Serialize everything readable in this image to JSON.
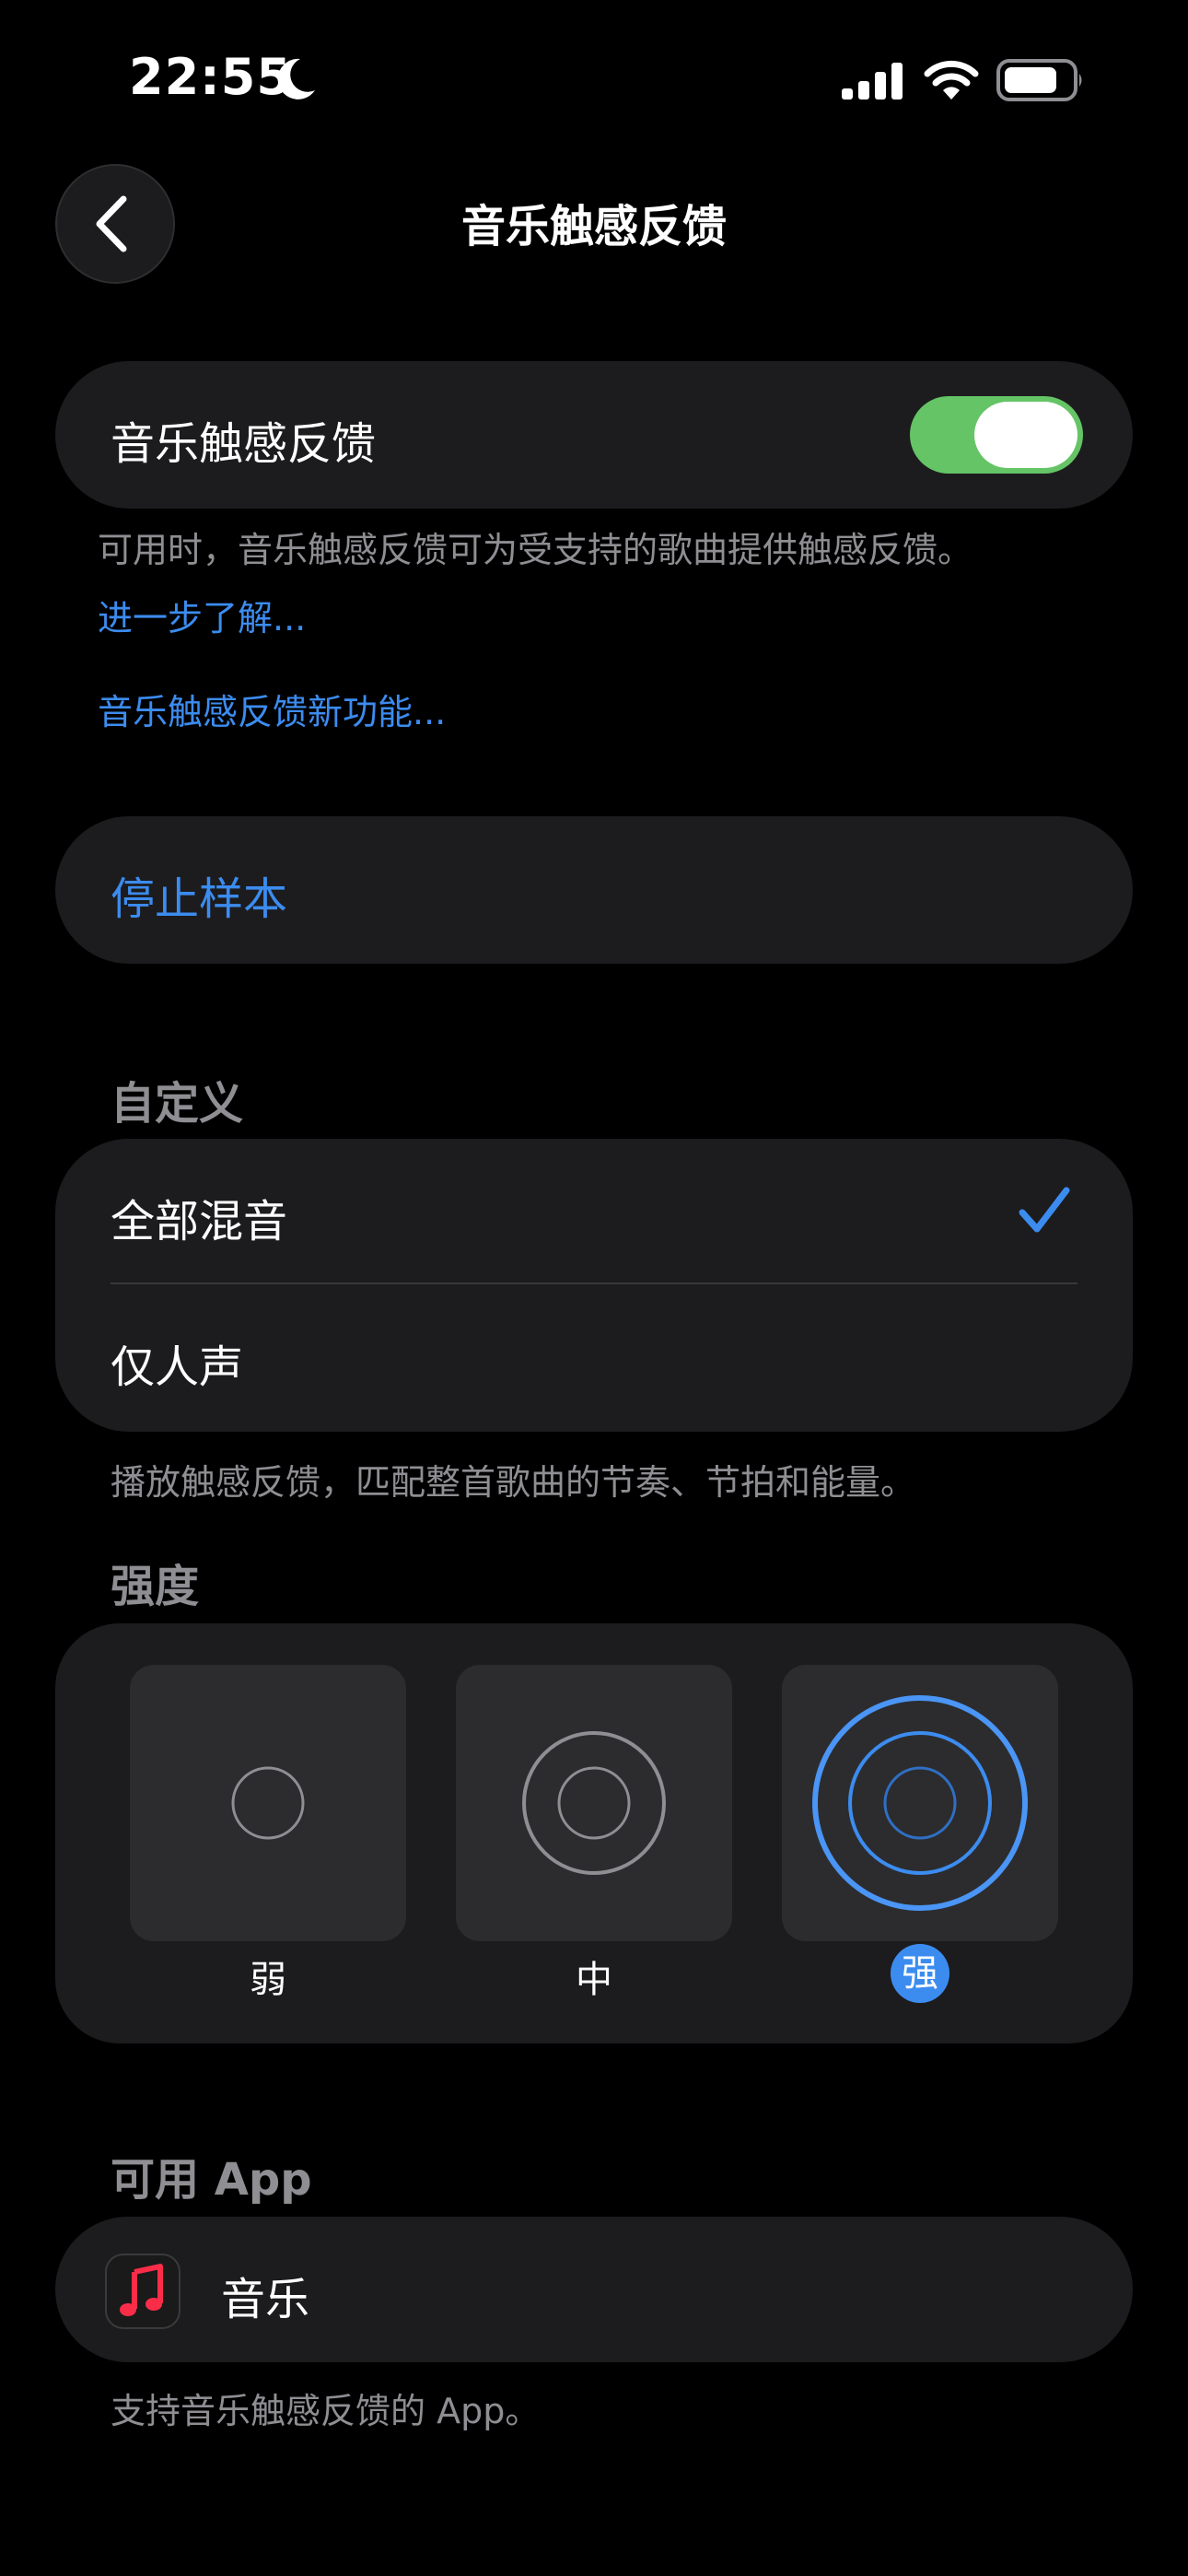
{
  "status_bar": {
    "time": "22:55",
    "icons": [
      "moon-icon",
      "cellular-signal-icon",
      "wifi-icon",
      "battery-icon"
    ]
  },
  "nav": {
    "title": "音乐触感反馈",
    "back_icon": "chevron-left-icon"
  },
  "haptics_toggle": {
    "label": "音乐触感反馈",
    "on": true,
    "color": "#65c466"
  },
  "description": {
    "text": "可用时，音乐触感反馈可为受支持的歌曲提供触感反馈。",
    "learn_more": "进一步了解...",
    "whats_new": "音乐触感反馈新功能..."
  },
  "sample": {
    "stop_label": "停止样本"
  },
  "customize": {
    "header": "自定义",
    "options": [
      {
        "label": "全部混音",
        "selected": true
      },
      {
        "label": "仅人声",
        "selected": false
      }
    ],
    "footnote": "播放触感反馈，匹配整首歌曲的节奏、节拍和能量。"
  },
  "intensity": {
    "header": "强度",
    "levels": [
      {
        "label": "弱",
        "selected": false
      },
      {
        "label": "中",
        "selected": false
      },
      {
        "label": "强",
        "selected": true
      }
    ],
    "accent": "#3c8cf0"
  },
  "apps": {
    "header": "可用 App",
    "items": [
      {
        "label": "音乐",
        "icon": "music-note-icon"
      }
    ],
    "footnote": "支持音乐触感反馈的 App。"
  }
}
